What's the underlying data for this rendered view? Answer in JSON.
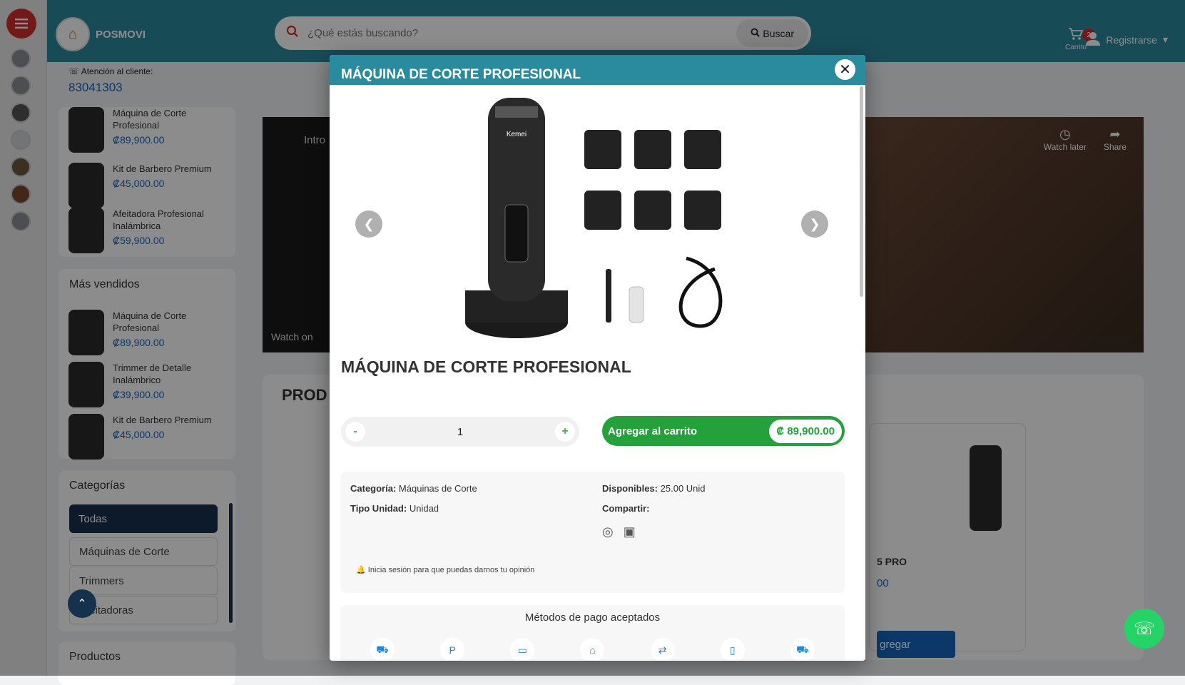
{
  "header": {
    "brand": "POSMOVI",
    "search_placeholder": "¿Qué estás buscando?",
    "search_button": "Buscar",
    "cart_label": "Carrito",
    "cart_count": "2",
    "user_label": "Registrarse"
  },
  "contact": {
    "label": "Atención al cliente:",
    "phone": "83041303"
  },
  "sidebar": {
    "recent": [
      {
        "name": "Máquina de Corte Profesional",
        "price": "₡89,900.00"
      },
      {
        "name": "Kit de Barbero Premium",
        "price": "₡45,000.00"
      },
      {
        "name": "Afeitadora Profesional Inalámbrica",
        "price": "₡59,900.00"
      }
    ],
    "bestsellers_title": "Más vendidos",
    "bestsellers": [
      {
        "name": "Máquina de Corte Profesional",
        "price": "₡89,900.00"
      },
      {
        "name": "Trimmer de Detalle Inalámbrico",
        "price": "₡39,900.00"
      },
      {
        "name": "Kit de Barbero Premium",
        "price": "₡45,000.00"
      }
    ],
    "categories_title": "Categorías",
    "categories": [
      "Todas",
      "Máquinas de Corte",
      "Trimmers",
      "Afeitadoras"
    ],
    "products_title": "Productos"
  },
  "video": {
    "watch_later": "Watch later",
    "share": "Share",
    "intro": "Intro",
    "watch_on": "Watch on"
  },
  "background": {
    "section_title": "PROD",
    "product_tail": "5 PRO",
    "price_tail": "00",
    "add_button_tail": "gregar"
  },
  "modal": {
    "header_title": "MÁQUINA DE CORTE PROFESIONAL",
    "product_title": "MÁQUINA DE CORTE PROFESIONAL",
    "quantity": "1",
    "add_to_cart": "Agregar al carrito",
    "price": "₡ 89,900.00",
    "categoria_label": "Categoría:",
    "categoria_value": "Máquinas de Corte",
    "tipo_label": "Tipo Unidad:",
    "tipo_value": "Unidad",
    "disponibles_label": "Disponibles:",
    "disponibles_value": "25.00 Unid",
    "compartir_label": "Compartir:",
    "login_note": "Inicia sesión para que puedas darnos tu opinión",
    "payment_title": "Métodos de pago aceptados",
    "image_brand": "Kemei"
  },
  "colors": {
    "header_teal": "#2a8a9e",
    "accent_red": "#d32f2f",
    "price_blue": "#1565c0",
    "cart_green": "#24a13b",
    "category_active": "#16314d"
  }
}
